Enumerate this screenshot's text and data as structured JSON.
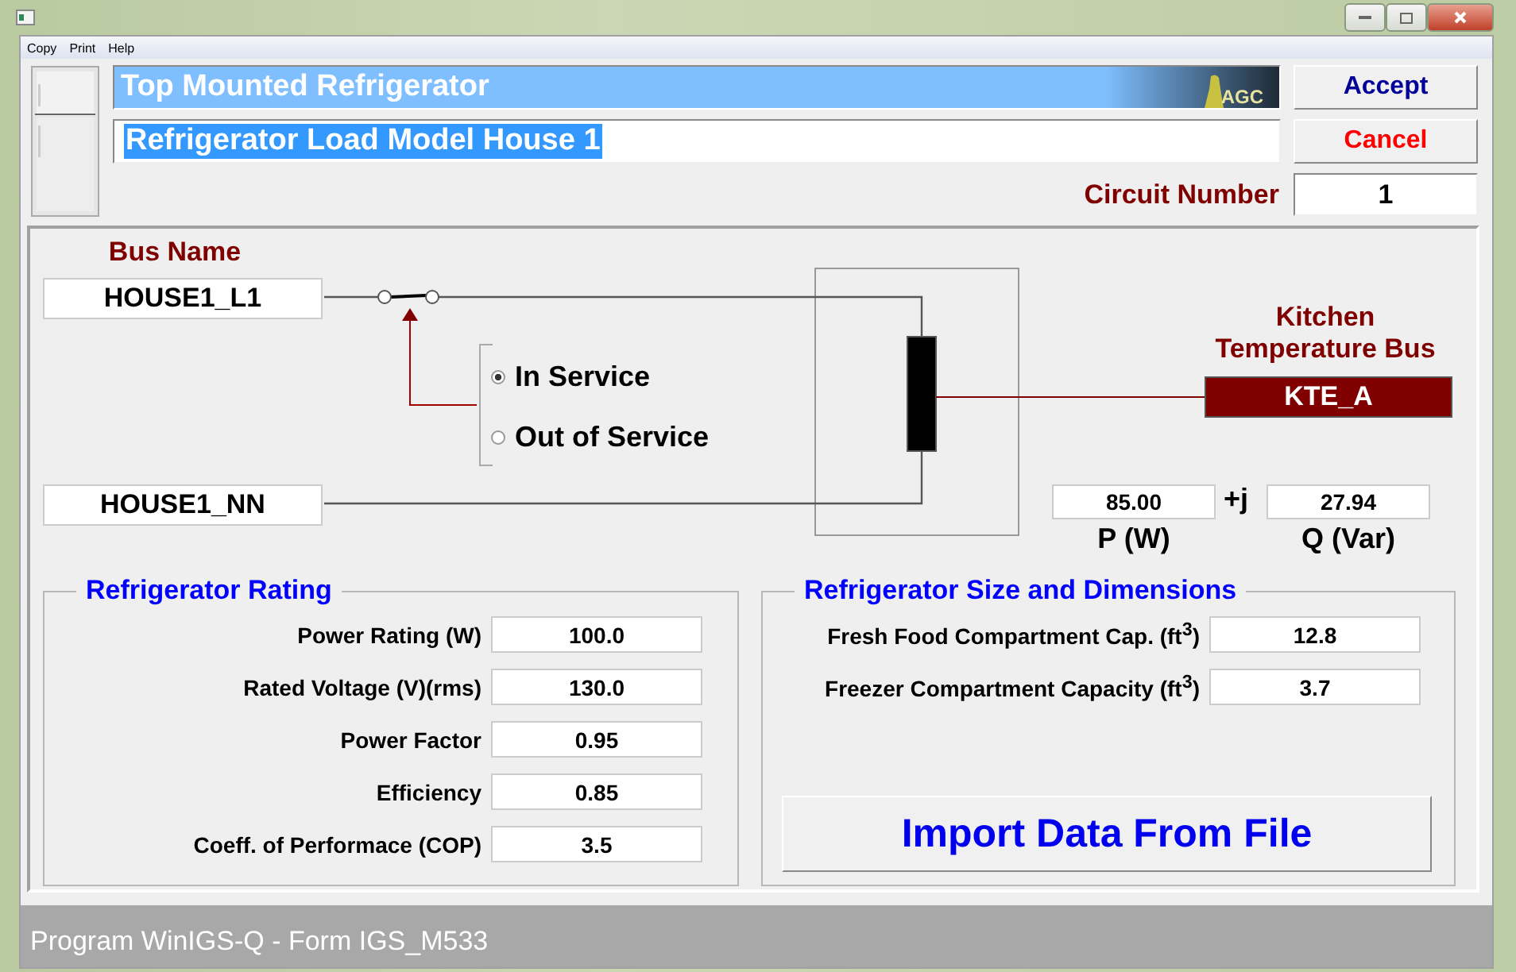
{
  "window": {
    "menu": [
      "Copy",
      "Print",
      "Help"
    ]
  },
  "header": {
    "type_title": "Top Mounted Refrigerator",
    "logo_text": "AGC",
    "name_value": "Refrigerator Load Model House 1",
    "name_selected": true,
    "buttons": [
      {
        "kind": "accept",
        "label": "Accept"
      },
      {
        "kind": "cancel",
        "label": "Cancel"
      }
    ],
    "circuit_label": "Circuit Number",
    "circuit_value": "1"
  },
  "diagram": {
    "bus_label": "Bus Name",
    "bus_1": "HOUSE1_L1",
    "bus_2": "HOUSE1_NN",
    "service": [
      {
        "label": "In Service",
        "selected": true
      },
      {
        "label": "Out of Service",
        "selected": false
      }
    ],
    "temp_bus_label": "Kitchen Temperature Bus",
    "temp_bus": "KTE_A",
    "p_value": "85.00",
    "j": "+j",
    "q_value": "27.94",
    "p_label": "P (W)",
    "q_label": "Q (Var)"
  },
  "rating": {
    "title": "Refrigerator Rating",
    "fields": [
      {
        "label": "Power Rating (W)",
        "value": "100.0"
      },
      {
        "label": "Rated Voltage (V)(rms)",
        "value": "130.0"
      },
      {
        "label": "Power Factor",
        "value": "0.95"
      },
      {
        "label": "Efficiency",
        "value": "0.85"
      },
      {
        "label": "Coeff. of Performace (COP)",
        "value": "3.5"
      }
    ]
  },
  "size": {
    "title": "Refrigerator Size and Dimensions",
    "fields": [
      {
        "label": "Fresh Food Compartment Cap. (ft$^{3}$)",
        "value": "12.8"
      },
      {
        "label": "Freezer Compartment Capacity (ft$^{3}$)",
        "value": "3.7"
      }
    ],
    "import_button": "Import Data From File"
  },
  "status_bar": "Program WinIGS-Q - Form IGS_M533"
}
